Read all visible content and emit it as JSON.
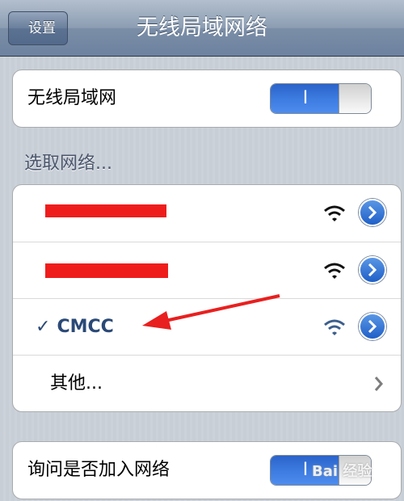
{
  "navbar": {
    "back_label": "设置",
    "title": "无线局域网络"
  },
  "wifi_toggle": {
    "label": "无线局域网",
    "state_label": "I",
    "on": true
  },
  "networks_header": "选取网络...",
  "networks": [
    {
      "name": "",
      "redacted": true,
      "selected": false,
      "icon": "wifi-icon"
    },
    {
      "name": "",
      "redacted": true,
      "selected": false,
      "icon": "wifi-icon"
    },
    {
      "name": "CMCC",
      "redacted": false,
      "selected": true,
      "check": "✓",
      "icon": "wifi-icon"
    }
  ],
  "other_network": {
    "label": "其他..."
  },
  "ask_join": {
    "label": "询问是否加入网络",
    "state_label": "I",
    "on": true
  },
  "watermark": "Bai 经验",
  "colors": {
    "accent": "#2f6fd6",
    "network_text": "#2a4977",
    "annotation_arrow": "#e8201f"
  }
}
